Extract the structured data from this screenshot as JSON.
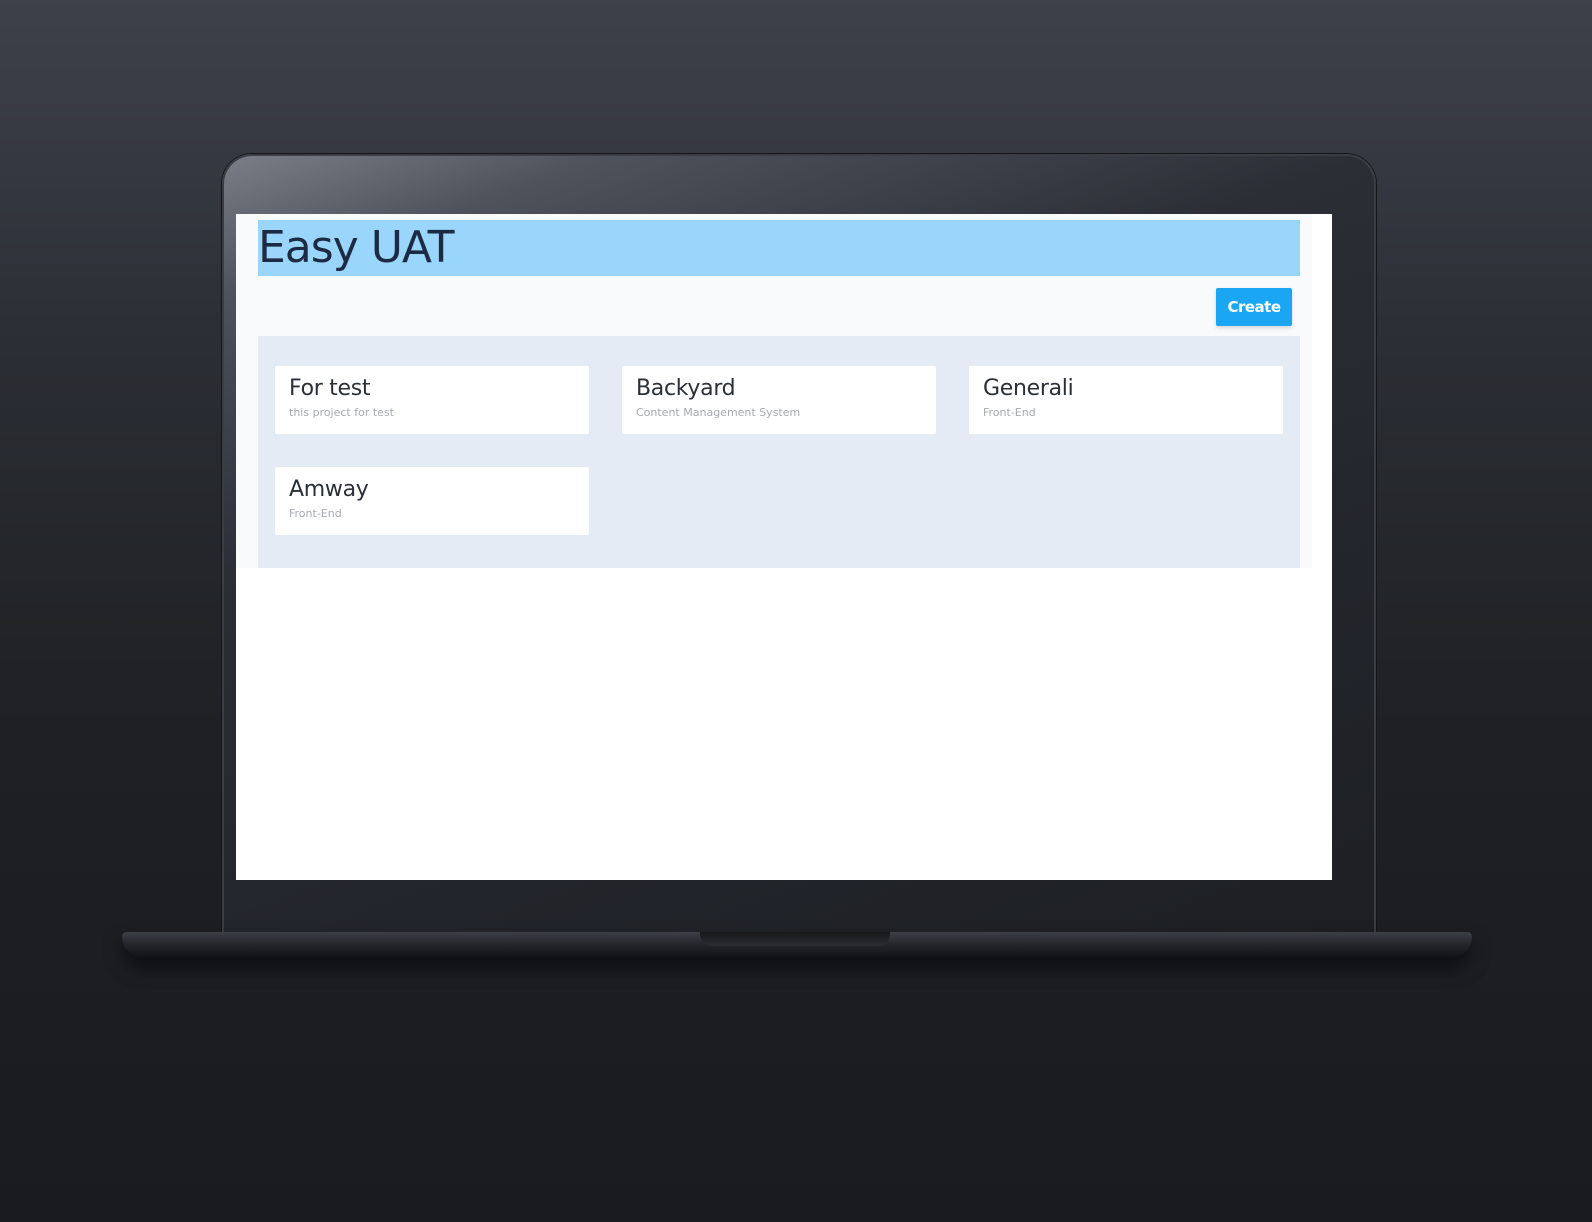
{
  "app": {
    "title": "Easy UAT",
    "create_label": "Create"
  },
  "projects": [
    {
      "name": "For test",
      "description": "this project for test"
    },
    {
      "name": "Backyard",
      "description": "Content Management System"
    },
    {
      "name": "Generali",
      "description": "Front-End"
    },
    {
      "name": "Amway",
      "description": "Front-End"
    }
  ],
  "colors": {
    "header_bg": "#9ad6fb",
    "title_text": "#1d2a44",
    "create_button": "#1aa6f3",
    "panel_bg": "#e5ebf5"
  }
}
